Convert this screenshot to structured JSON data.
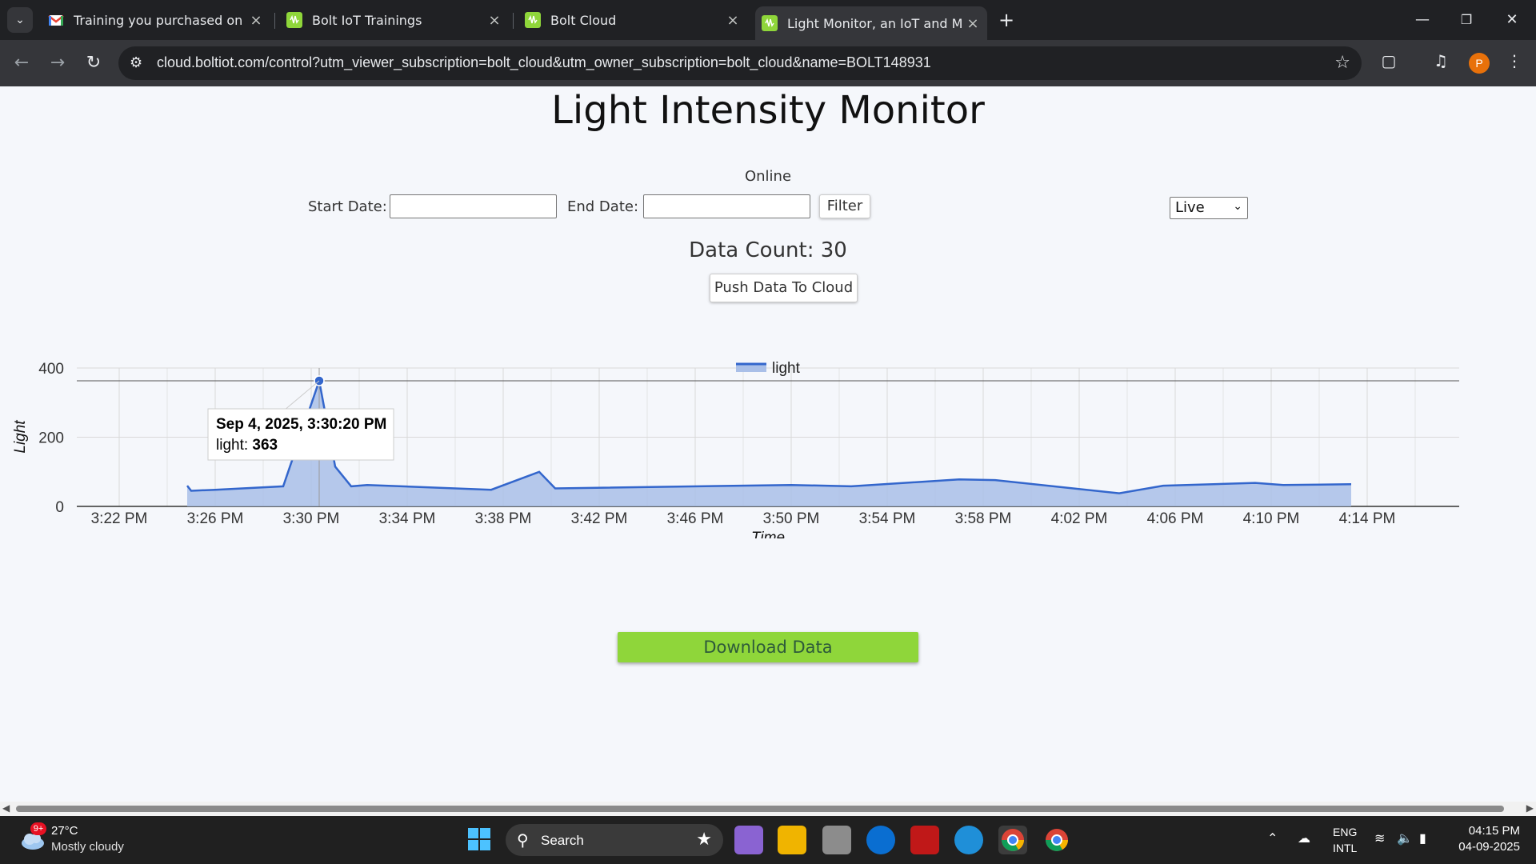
{
  "browser": {
    "tabs": [
      {
        "title": "Training you purchased on shop",
        "icon": "gmail-icon"
      },
      {
        "title": "Bolt IoT Trainings",
        "icon": "bolt-icon"
      },
      {
        "title": "Bolt Cloud",
        "icon": "bolt-icon"
      },
      {
        "title": "Light Monitor, an IoT and ML p",
        "icon": "bolt-icon",
        "active": true
      }
    ],
    "url": "cloud.boltiot.com/control?utm_viewer_subscription=bolt_cloud&utm_owner_subscription=bolt_cloud&name=BOLT148931",
    "profile_initial": "P"
  },
  "page": {
    "title": "Light Intensity Monitor",
    "status": "Online",
    "start_date_label": "Start Date:",
    "end_date_label": "End Date:",
    "start_date_value": "",
    "end_date_value": "",
    "filter_label": "Filter",
    "mode_select": "Live",
    "data_count": "Data Count: 30",
    "push_label": "Push Data To Cloud",
    "download_label": "Download Data"
  },
  "chart_data": {
    "type": "area",
    "xlabel": "Time",
    "ylabel": "Light",
    "legend": [
      "light"
    ],
    "legend_position": "top-center",
    "grid": true,
    "x_ticks": [
      "3:22 PM",
      "3:26 PM",
      "3:30 PM",
      "3:34 PM",
      "3:38 PM",
      "3:42 PM",
      "3:46 PM",
      "3:50 PM",
      "3:54 PM",
      "3:58 PM",
      "4:02 PM",
      "4:06 PM",
      "4:10 PM",
      "4:14 PM"
    ],
    "y_ticks": [
      0,
      200,
      400
    ],
    "ylim": [
      0,
      400
    ],
    "series": [
      {
        "name": "light",
        "color": "#3366cc",
        "points": [
          [
            "3:24:50 PM",
            60
          ],
          [
            "3:25:00 PM",
            45
          ],
          [
            "3:26:00 PM",
            48
          ],
          [
            "3:28:50 PM",
            58
          ],
          [
            "3:30:20 PM",
            363
          ],
          [
            "3:31:00 PM",
            115
          ],
          [
            "3:31:40 PM",
            58
          ],
          [
            "3:32:20 PM",
            62
          ],
          [
            "3:37:30 PM",
            48
          ],
          [
            "3:39:30 PM",
            100
          ],
          [
            "3:40:10 PM",
            52
          ],
          [
            "3:50:00 PM",
            62
          ],
          [
            "3:52:30 PM",
            58
          ],
          [
            "3:57:00 PM",
            78
          ],
          [
            "3:58:30 PM",
            76
          ],
          [
            "4:03:40 PM",
            38
          ],
          [
            "4:05:30 PM",
            60
          ],
          [
            "4:09:20 PM",
            68
          ],
          [
            "4:10:30 PM",
            62
          ],
          [
            "4:13:20 PM",
            64
          ]
        ]
      }
    ],
    "tooltip": {
      "title": "Sep 4, 2025, 3:30:20 PM",
      "series": "light",
      "value": "363"
    }
  },
  "taskbar": {
    "weather_badge": "9+",
    "temperature": "27°C",
    "condition": "Mostly cloudy",
    "search_label": "Search",
    "lang_top": "ENG",
    "lang_bottom": "INTL",
    "time": "04:15 PM",
    "date": "04-09-2025"
  },
  "colors": {
    "accent": "#8fd63a",
    "chart_line": "#3366cc",
    "chart_fill": "#a9bfe8"
  }
}
